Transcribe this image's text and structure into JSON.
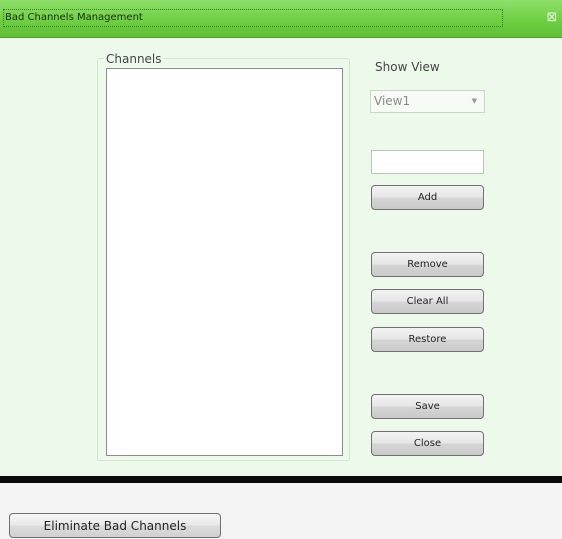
{
  "window": {
    "title": "Bad Channels Management",
    "close_icon": "close-icon",
    "accent": "#6fcf43",
    "background": "#edf9ea"
  },
  "channels": {
    "label": "Channels",
    "items": []
  },
  "view": {
    "label": "Show View",
    "selected": "View1",
    "chevron_icon": "chevron-down-icon"
  },
  "input": {
    "value": "",
    "placeholder": ""
  },
  "buttons": {
    "add": "Add",
    "remove": "Remove",
    "clear_all": "Clear All",
    "restore": "Restore",
    "save": "Save",
    "close": "Close"
  },
  "footer": {
    "eliminate_label": "Eliminate Bad Channels"
  }
}
